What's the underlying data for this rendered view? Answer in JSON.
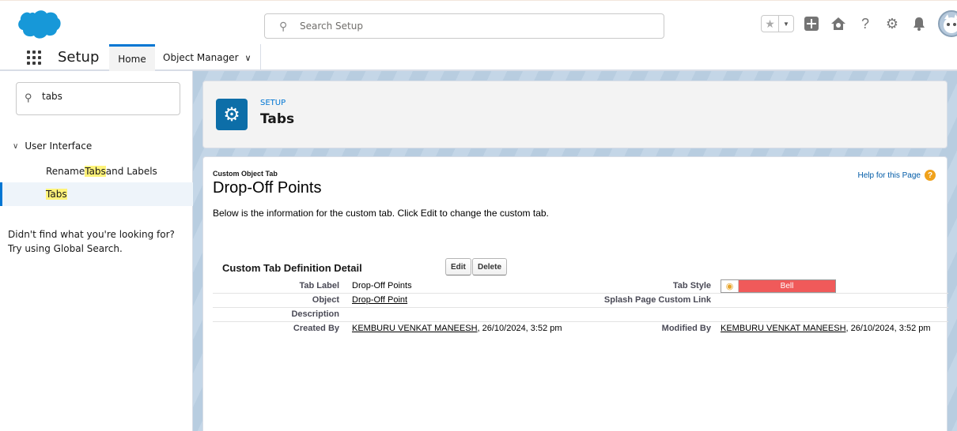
{
  "header": {
    "search_placeholder": "Search Setup"
  },
  "context_bar": {
    "app_name": "Setup",
    "tabs": [
      {
        "label": "Home"
      },
      {
        "label": "Object Manager"
      }
    ]
  },
  "sidebar": {
    "quickfind_value": "tabs",
    "tree": {
      "parent_label": "User Interface",
      "items": [
        {
          "before": "Rename ",
          "highlight": "Tabs",
          "after": " and Labels"
        },
        {
          "before": "",
          "highlight": "Tabs",
          "after": ""
        }
      ]
    },
    "not_found_line1": "Didn't find what you're looking for?",
    "not_found_line2": "Try using Global Search."
  },
  "page_header": {
    "eyebrow": "SETUP",
    "title": "Tabs"
  },
  "detail": {
    "eyebrow": "Custom Object Tab",
    "title": "Drop-Off Points",
    "help_link": "Help for this Page",
    "intro": "Below is the information for the custom tab. Click Edit to change the custom tab.",
    "section_title": "Custom Tab Definition Detail",
    "buttons": {
      "edit": "Edit",
      "delete": "Delete"
    },
    "fields": {
      "tab_label": {
        "label": "Tab Label",
        "value": "Drop-Off Points"
      },
      "tab_style": {
        "label": "Tab Style",
        "value": "Bell",
        "color": "#f05a5a"
      },
      "object": {
        "label": "Object",
        "value": "Drop-Off Point"
      },
      "splash": {
        "label": "Splash Page Custom Link",
        "value": ""
      },
      "description": {
        "label": "Description",
        "value": ""
      },
      "created_by": {
        "label": "Created By",
        "user": "KEMBURU VENKAT MANEESH",
        "date": ", 26/10/2024, 3:52 pm"
      },
      "modified_by": {
        "label": "Modified By",
        "user": "KEMBURU VENKAT MANEESH",
        "date": ", 26/10/2024, 3:52 pm"
      }
    }
  },
  "colors": {
    "brand_blue": "#0176d3",
    "logo_blue": "#1798d8",
    "setup_icon_bg": "#0d6ea8",
    "highlight": "#fff37a"
  }
}
